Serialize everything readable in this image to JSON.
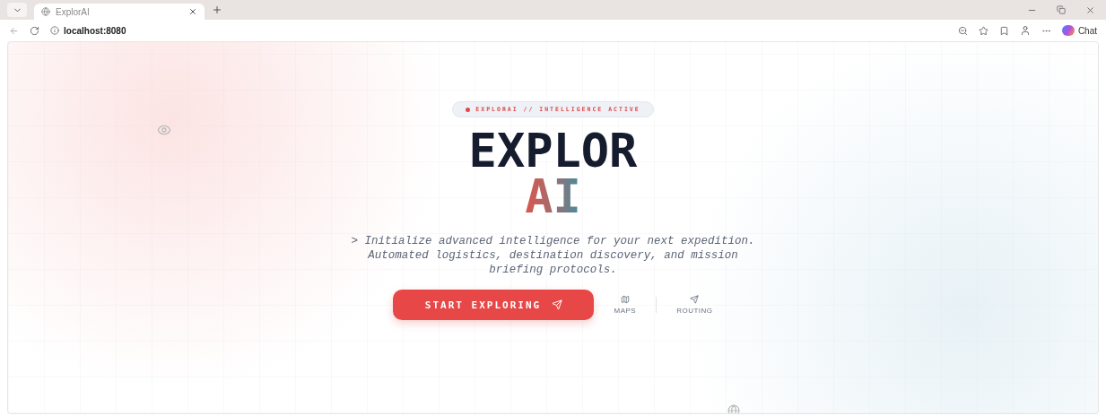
{
  "browser": {
    "tab": {
      "title": "ExplorAI",
      "selected": true
    },
    "address": "localhost:8080",
    "chat": "Chat"
  },
  "hero": {
    "badge": "EXPLORAI // INTELLIGENCE ACTIVE",
    "title": "EXPLOR",
    "title_accent": "AI",
    "tagline": "> Initialize advanced intelligence for your next expedition. Automated logistics, destination discovery, and mission briefing protocols.",
    "cta": "START EXPLORING",
    "features": [
      {
        "kind": "map",
        "label": "MAPS"
      },
      {
        "kind": "routing",
        "label": "ROUTING"
      }
    ]
  }
}
